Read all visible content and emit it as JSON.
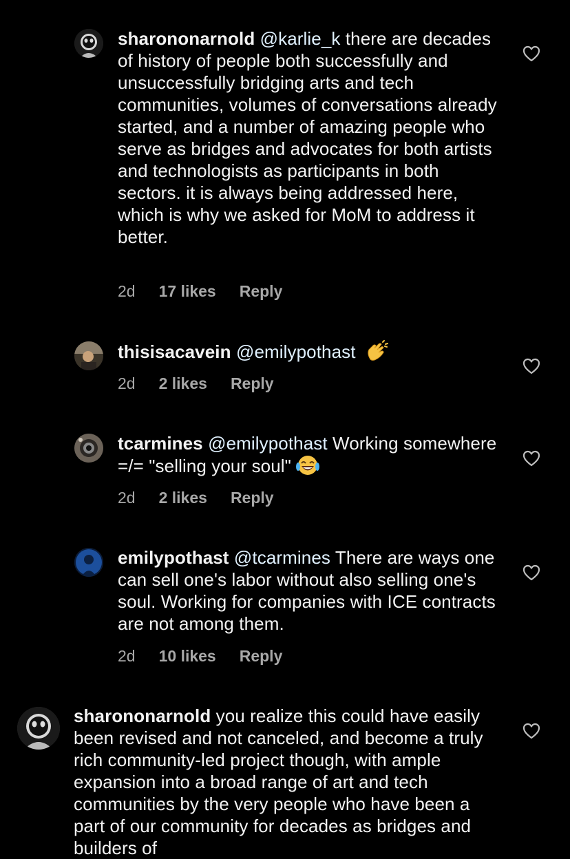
{
  "comments": [
    {
      "username": "sharononarnold",
      "mention": "@karlie_k",
      "text": " there are decades of history of people both successfully and unsuccessfully bridging arts and tech communities, volumes of conversations already started, and a number of amazing people who serve as bridges and advocates for both artists and technologists as participants in both sectors. it is always being addressed here, which is why we asked for MoM to address it better.",
      "age": "2d",
      "likes": "17 likes",
      "reply": "Reply"
    },
    {
      "username": "thisisacavein",
      "mention": "@emilypothast",
      "text": " ",
      "emoji": "clapping-hands-icon",
      "age": "2d",
      "likes": "2 likes",
      "reply": "Reply"
    },
    {
      "username": "tcarmines",
      "mention": "@emilypothast",
      "text": " Working somewhere =/= \"selling your soul\"",
      "emoji": "tears-of-joy-icon",
      "age": "2d",
      "likes": "2 likes",
      "reply": "Reply"
    },
    {
      "username": "emilypothast",
      "mention": "@tcarmines",
      "text": " There are ways one can sell one's labor without also selling one's soul. Working for companies with ICE contracts are not among them.",
      "age": "2d",
      "likes": "10 likes",
      "reply": "Reply"
    },
    {
      "username": "sharononarnold",
      "mention": "",
      "text": " you realize this could have easily been revised and not canceled, and become a truly rich community-led project though, with ample expansion into a broad range of art and tech communities by the very people who have been a part of our community for decades as bridges and builders of"
    }
  ],
  "colors": {
    "background": "#000000",
    "text": "#f2f2f2",
    "secondary": "#a8a8a8",
    "mention": "#e0f1ff"
  }
}
